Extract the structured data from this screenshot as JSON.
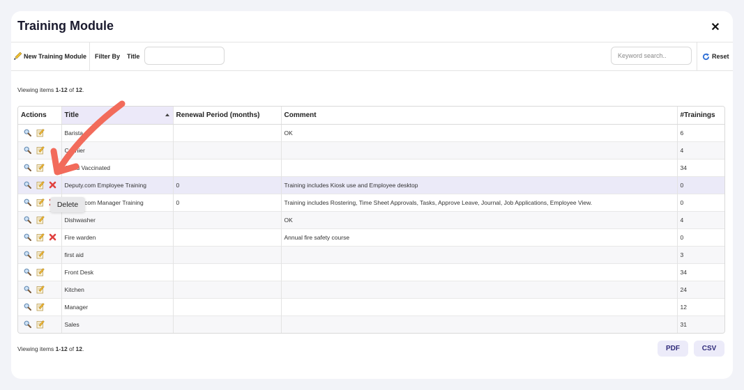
{
  "modal": {
    "title": "Training Module",
    "close_label": "✕"
  },
  "toolbar": {
    "new_label": "New Training Module",
    "filter_label": "Filter By",
    "title_label": "Title",
    "title_value": "",
    "search_placeholder": "Keyword search..",
    "reset_label": "Reset"
  },
  "summary": {
    "prefix": "Viewing items ",
    "range": "1-12",
    "of": " of ",
    "total": "12",
    "suffix": "."
  },
  "table": {
    "columns": [
      "Actions",
      "Title",
      "Renewal Period (months)",
      "Comment",
      "#Trainings"
    ],
    "rows": [
      {
        "title": "Barista",
        "renewal": "",
        "comment": "OK",
        "trainings": "6",
        "deletable": false
      },
      {
        "title": "Cashier",
        "renewal": "",
        "comment": "",
        "trainings": "4",
        "deletable": false
      },
      {
        "title": "Covid Vaccinated",
        "renewal": "",
        "comment": "",
        "trainings": "34",
        "deletable": false
      },
      {
        "title": "Deputy.com Employee Training",
        "renewal": "0",
        "comment": "Training includes Kiosk use and Employee desktop",
        "trainings": "0",
        "deletable": true
      },
      {
        "title": "Deputy.com Manager Training",
        "renewal": "0",
        "comment": "Training includes Rostering, Time Sheet Approvals, Tasks, Approve Leave, Journal, Job Applications, Employee View.",
        "trainings": "0",
        "deletable": true
      },
      {
        "title": "Dishwasher",
        "renewal": "",
        "comment": "OK",
        "trainings": "4",
        "deletable": false
      },
      {
        "title": "Fire warden",
        "renewal": "",
        "comment": "Annual fire safety course",
        "trainings": "0",
        "deletable": true
      },
      {
        "title": "first aid",
        "renewal": "",
        "comment": "",
        "trainings": "3",
        "deletable": false
      },
      {
        "title": "Front Desk",
        "renewal": "",
        "comment": "",
        "trainings": "34",
        "deletable": false
      },
      {
        "title": "Kitchen",
        "renewal": "",
        "comment": "",
        "trainings": "24",
        "deletable": false
      },
      {
        "title": "Manager",
        "renewal": "",
        "comment": "",
        "trainings": "12",
        "deletable": false
      },
      {
        "title": "Sales",
        "renewal": "",
        "comment": "",
        "trainings": "31",
        "deletable": false
      }
    ]
  },
  "tooltip": {
    "text": "Delete"
  },
  "footer": {
    "pdf_label": "PDF",
    "csv_label": "CSV"
  },
  "colors": {
    "accent": "#2f2a7a",
    "highlight_row": "#ebeaf8",
    "arrow": "#f26b5b",
    "delete": "#e0403f"
  }
}
